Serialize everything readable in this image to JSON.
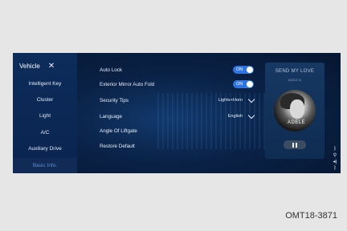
{
  "sidebar": {
    "title": "Vehicle",
    "items": [
      {
        "label": "Intelligent Key"
      },
      {
        "label": "Cluster"
      },
      {
        "label": "Light"
      },
      {
        "label": "A/C"
      },
      {
        "label": "Auxiliary Drive"
      },
      {
        "label": "Basic Info."
      }
    ],
    "active_index": 5
  },
  "settings": {
    "auto_lock": {
      "label": "Auto Lock",
      "state": "ON"
    },
    "mirror_fold": {
      "label": "Exterior Mirror Auto Fold",
      "state": "ON"
    },
    "security_tips": {
      "label": "Security Tips",
      "value": "Lights+Horn"
    },
    "language": {
      "label": "Language",
      "value": "English"
    },
    "liftgate_angle": {
      "label": "Angle Of Liftgate"
    },
    "restore_default": {
      "label": "Restore Default"
    }
  },
  "media": {
    "song": "SEND MY LOVE",
    "artist": "ADELE 21",
    "album_text": "ADELE"
  },
  "colors": {
    "toggle_on": "#2f74e0",
    "active_sidebar": "#5d8fd6",
    "background": "#0a2247"
  },
  "icons": {
    "status": [
      "bluetooth-icon",
      "usb-icon",
      "volume-icon",
      "bluetooth-small-icon",
      "battery-icon"
    ]
  },
  "caption": "OMT18-3871"
}
